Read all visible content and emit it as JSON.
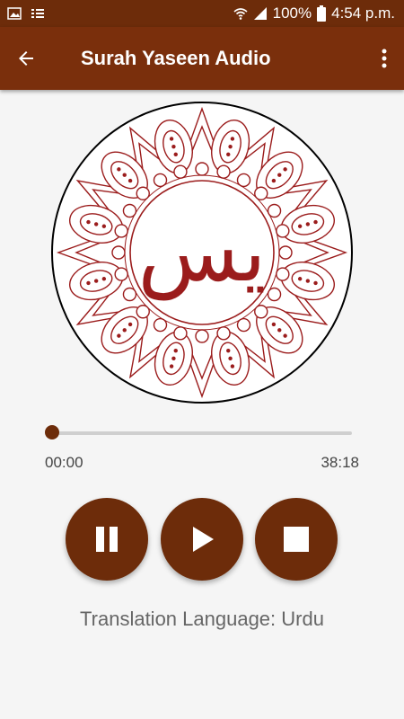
{
  "status_bar": {
    "battery_percent": "100%",
    "time": "4:54 p.m.",
    "icons": [
      "image-icon",
      "list-icon",
      "wifi-icon",
      "signal-icon",
      "battery-icon"
    ]
  },
  "app_bar": {
    "title": "Surah Yaseen Audio",
    "back_icon": "arrow-left-icon",
    "menu_icon": "more-vertical-icon"
  },
  "artwork": {
    "calligraphy": "يس",
    "accent_color": "#9b1c1c"
  },
  "player": {
    "current_time": "00:00",
    "total_time": "38:18",
    "progress_fraction": 0.0,
    "controls": [
      "pause-icon",
      "play-icon",
      "stop-icon"
    ]
  },
  "footer": {
    "translation_text": "Translation Language: Urdu"
  },
  "colors": {
    "primary": "#7a2f0c",
    "status_bar": "#6d2c0a",
    "background": "#f5f5f5"
  }
}
